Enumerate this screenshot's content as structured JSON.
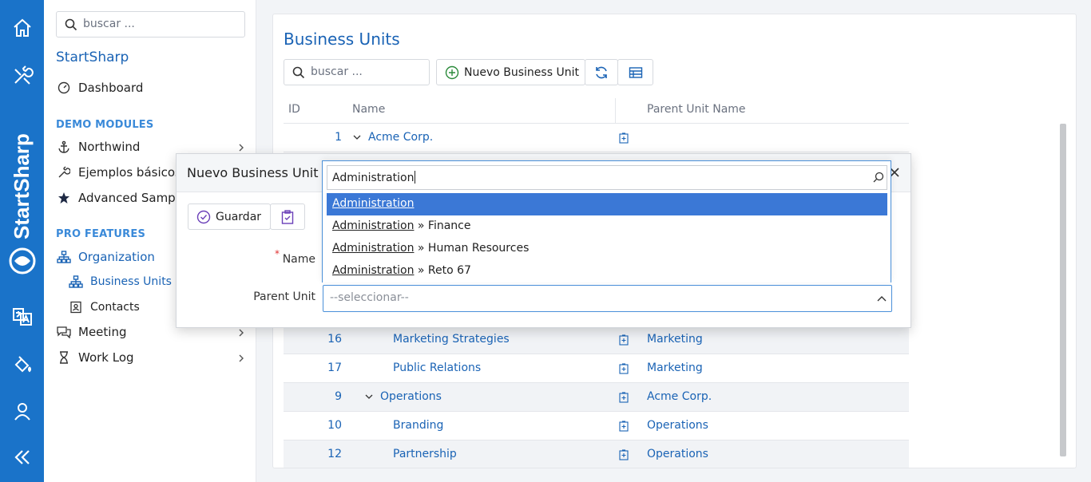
{
  "rail": {
    "icons": [
      "home-icon",
      "tools-icon",
      "translate-icon",
      "paint-bucket-icon",
      "user-icon",
      "collapse-icon"
    ],
    "brand": "StartSharp",
    "accent": "#1a73c9"
  },
  "sidebar": {
    "search_placeholder": "buscar ...",
    "brand": "StartSharp",
    "dashboard": "Dashboard",
    "demo_header": "DEMO MODULES",
    "northwind": "Northwind",
    "ejemplos": "Ejemplos básicos",
    "advanced": "Advanced Samples",
    "pro_header": "PRO FEATURES",
    "organization": "Organization",
    "business_units": "Business Units",
    "contacts": "Contacts",
    "meeting": "Meeting",
    "work_log": "Work Log"
  },
  "main": {
    "title": "Business Units",
    "search_placeholder": "buscar ...",
    "new_button": "Nuevo Business Unit",
    "columns": {
      "id": "ID",
      "name": "Name",
      "parent": "Parent Unit Name"
    },
    "rows": [
      {
        "id": "1",
        "name": "Acme Corp.",
        "parent": "",
        "level": 0,
        "expandable": true
      },
      {
        "id": "16",
        "name": "Marketing Strategies",
        "parent": "Marketing",
        "level": 2,
        "expandable": false
      },
      {
        "id": "17",
        "name": "Public Relations",
        "parent": "Marketing",
        "level": 2,
        "expandable": false
      },
      {
        "id": "9",
        "name": "Operations",
        "parent": "Acme Corp.",
        "level": 1,
        "expandable": true
      },
      {
        "id": "10",
        "name": "Branding",
        "parent": "Operations",
        "level": 2,
        "expandable": false
      },
      {
        "id": "12",
        "name": "Partnership",
        "parent": "Operations",
        "level": 2,
        "expandable": false
      }
    ]
  },
  "dialog": {
    "title": "Nuevo Business Unit",
    "save": "Guardar",
    "name_label": "Name",
    "required_mark": "*",
    "parent_label": "Parent Unit",
    "parent_placeholder": "--seleccionar--",
    "search_value": "Administration",
    "options": [
      {
        "match": "Administration",
        "rest": "",
        "highlighted": true
      },
      {
        "match": "Administration",
        "rest": " » Finance",
        "highlighted": false
      },
      {
        "match": "Administration",
        "rest": " » Human Resources",
        "highlighted": false
      },
      {
        "match": "Administration",
        "rest": " » Reto 67",
        "highlighted": false
      }
    ]
  }
}
